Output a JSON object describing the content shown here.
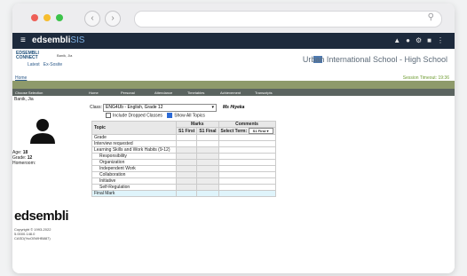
{
  "browser": {
    "search_icon": "⚲"
  },
  "app": {
    "brand_main": "edsembli",
    "brand_suffix": "SIS"
  },
  "header": {
    "student_name": "Banik, Jia",
    "links": [
      "Latest",
      "Ex-Sosite"
    ],
    "logo_text": [
      "EDSEMBLI",
      "CONNECT"
    ]
  },
  "school": {
    "name": "Urban International School - High School"
  },
  "nav": {
    "home": "Home",
    "timeout": "Session Timeout: 19:36"
  },
  "tabs": [
    "Choose Selection",
    "Home",
    "Personal",
    "Attendance",
    "Timetables",
    "Achievement",
    "Transcripts"
  ],
  "student": {
    "name": "Banik, Jia",
    "age_label": "Age:",
    "age": "18",
    "grade_label": "Grade:",
    "grade": "12",
    "homeroom_label": "Homeroom:"
  },
  "footer": {
    "logo": "edsembli",
    "copyright": "Copyright © 1993-2022",
    "version": "5.0000.148.0",
    "code": "CASD(%cO0WHB887)"
  },
  "main": {
    "class_label": "Class:",
    "class_value": "ENG4Ub - English, Grade 12",
    "teacher": "Ms Hiyeka",
    "include_dropped": "Include Dropped Classes",
    "show_all": "Show All Topics",
    "col_topic": "Topic",
    "col_marks": "Marks",
    "col_comments": "Comments",
    "col_s1_first": "S1 First",
    "col_s1_final": "S1 Final",
    "col_select_term": "Select Term:",
    "term_value": "S1 First",
    "rows": [
      "Grade",
      "Interview requested",
      "Learning Skills and Work Habits (9-12)",
      "Responsibility",
      "Organization",
      "Independent Work",
      "Collaboration",
      "Initiative",
      "Self-Regulation",
      "Final Mark"
    ]
  }
}
